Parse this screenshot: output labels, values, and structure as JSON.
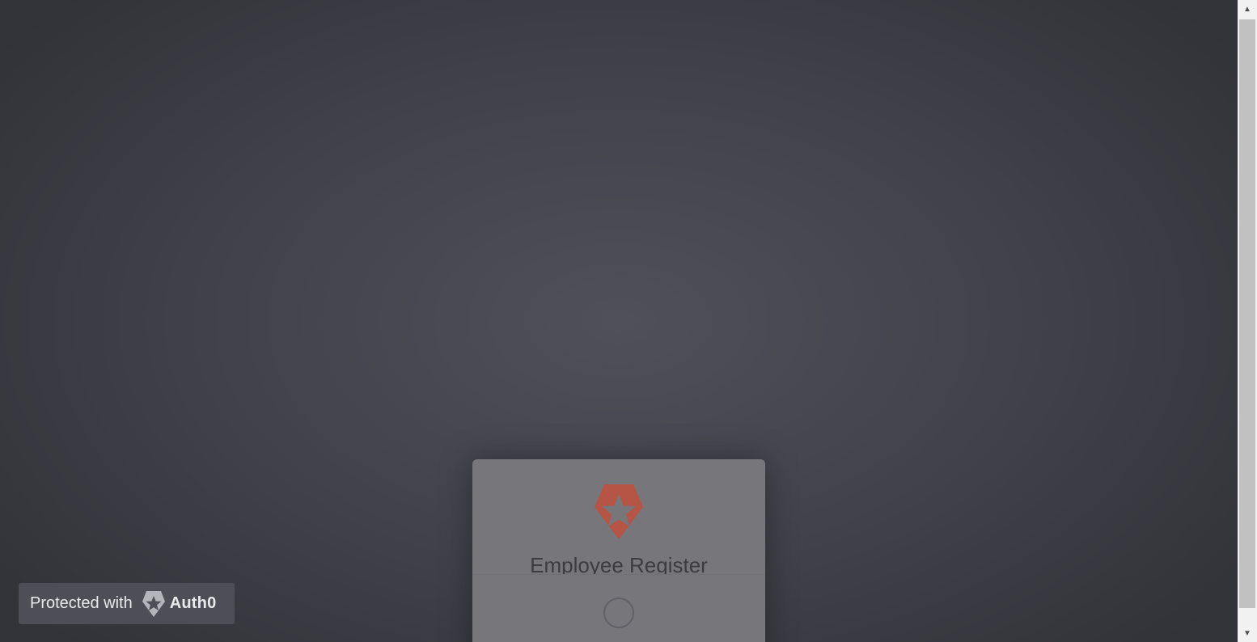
{
  "login": {
    "title": "Employee Register",
    "logo_icon": "auth0-shield-star-icon",
    "loading_icon": "loading-spinner-icon",
    "brand_color": "#c0503c"
  },
  "badge": {
    "text": "Protected with",
    "brand": "Auth0",
    "icon": "auth0-logo-icon"
  },
  "scrollbar": {
    "up_arrow": "▲",
    "down_arrow": "▼"
  }
}
